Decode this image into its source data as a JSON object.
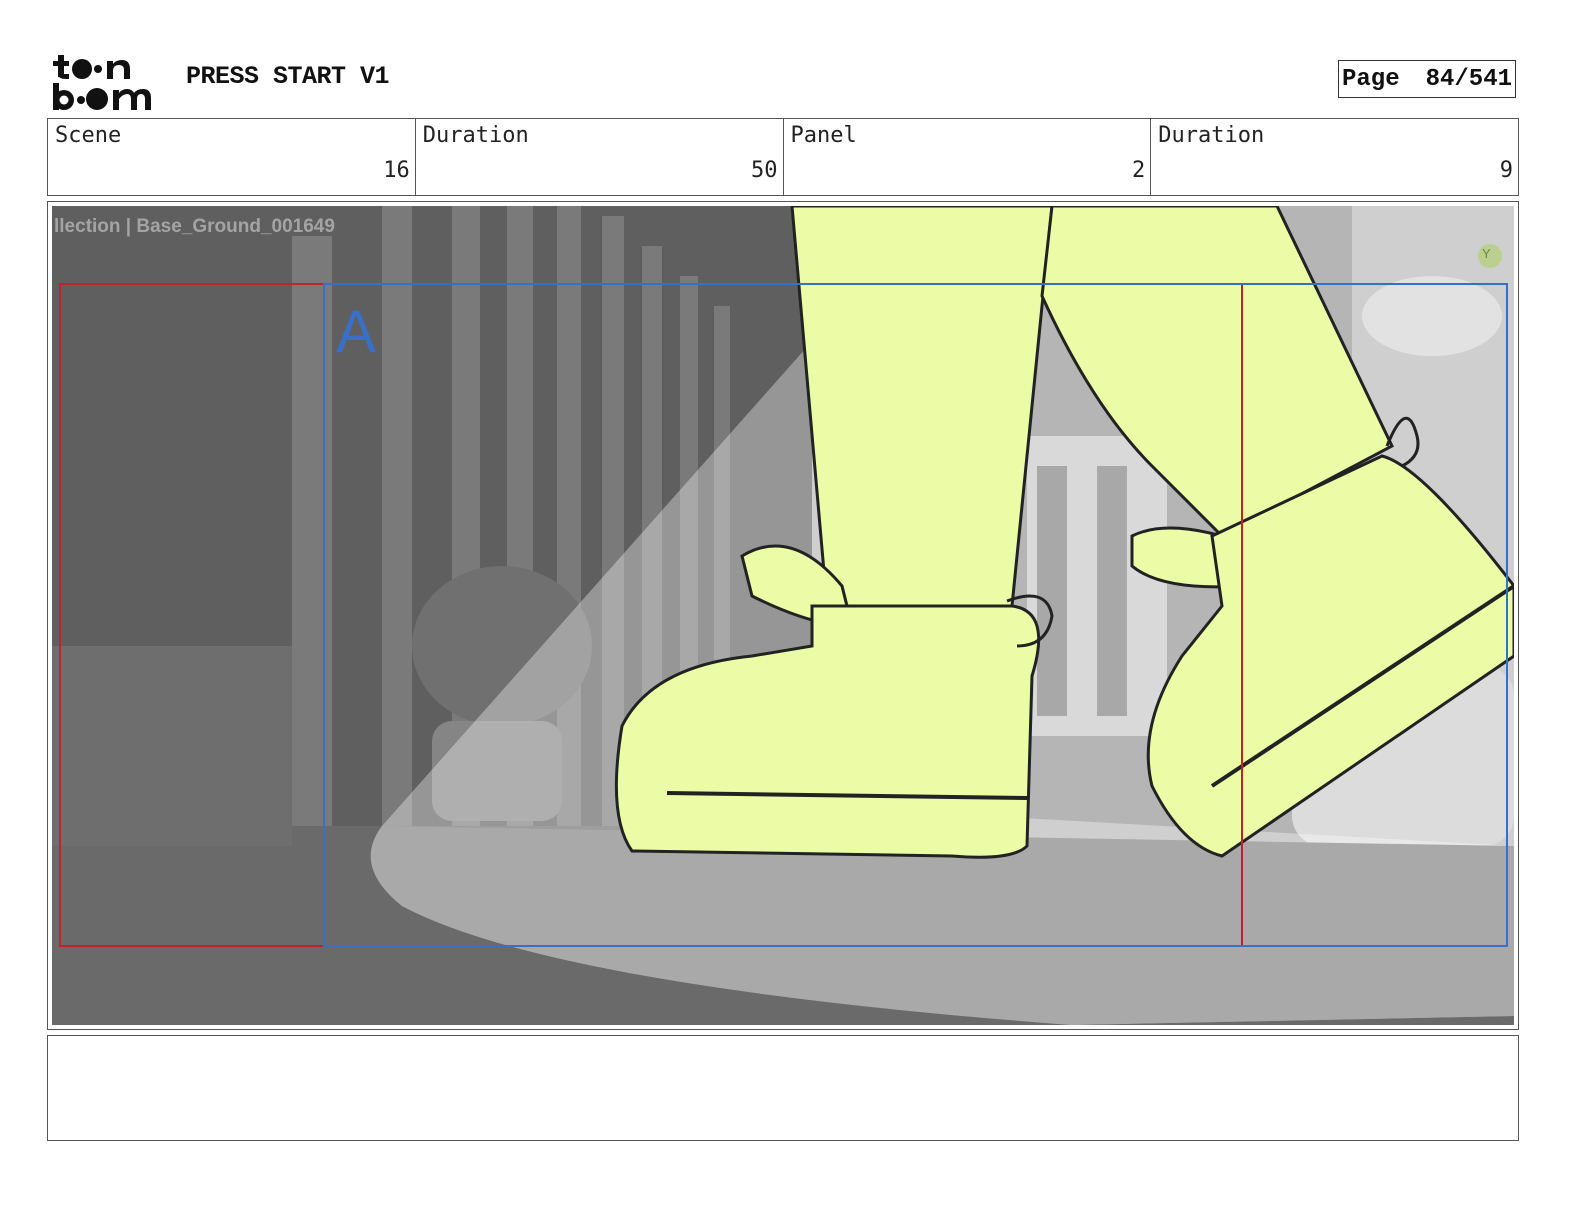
{
  "header": {
    "logo_text": "toon boom",
    "project_title": "PRESS START V1",
    "page_label": "Page",
    "page_number": "84/541"
  },
  "info": {
    "scene_label": "Scene",
    "scene_value": "16",
    "scene_duration_label": "Duration",
    "scene_duration_value": "50",
    "panel_label": "Panel",
    "panel_value": "2",
    "panel_duration_label": "Duration",
    "panel_duration_value": "9"
  },
  "panel": {
    "layer_label": "llection | Base_Ground_001649",
    "field_letter": "A",
    "camera_tag": "Y"
  },
  "notes": {
    "text": ""
  }
}
